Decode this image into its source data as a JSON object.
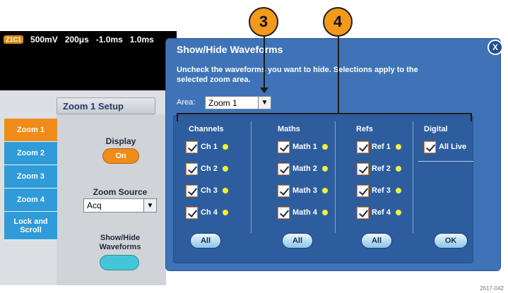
{
  "scope_bar": {
    "channel_badge": "Z1C1",
    "volts": "500mV",
    "timebase": "200μs",
    "position": "-1.0ms",
    "zoom_time": "1.0ms"
  },
  "zoom_setup": {
    "title": "Zoom 1 Setup",
    "tabs": [
      "Zoom 1",
      "Zoom 2",
      "Zoom 3",
      "Zoom 4",
      "Lock and Scroll"
    ],
    "active_tab": "Zoom 1",
    "display_label": "Display",
    "display_value": "On",
    "zoom_source_label": "Zoom Source",
    "zoom_source_value": "Acq",
    "show_hide_label": "Show/Hide Waveforms"
  },
  "dialog": {
    "title": "Show/Hide Waveforms",
    "close_label": "X",
    "instructions": "Uncheck the waveforms you want to hide. Selections apply to the selected zoom area.",
    "area_label": "Area:",
    "area_value": "Zoom 1",
    "columns": {
      "channels": {
        "heading": "Channels",
        "items": [
          "Ch 1",
          "Ch 2",
          "Ch 3",
          "Ch 4"
        ],
        "all_label": "All"
      },
      "maths": {
        "heading": "Maths",
        "items": [
          "Math 1",
          "Math 2",
          "Math 3",
          "Math 4"
        ],
        "all_label": "All"
      },
      "refs": {
        "heading": "Refs",
        "items": [
          "Ref 1",
          "Ref 2",
          "Ref 3",
          "Ref 4"
        ],
        "all_label": "All"
      },
      "digital": {
        "heading": "Digital",
        "items": [
          "All Live"
        ]
      }
    },
    "ok_label": "OK"
  },
  "callouts": [
    "3",
    "4"
  ],
  "figure_code": "2617-042",
  "colors": {
    "accent_orange": "#f08c1a",
    "tab_blue": "#2f9bd9",
    "dialog_blue": "#3f73b7",
    "led_yellow": "#f2f23a"
  }
}
